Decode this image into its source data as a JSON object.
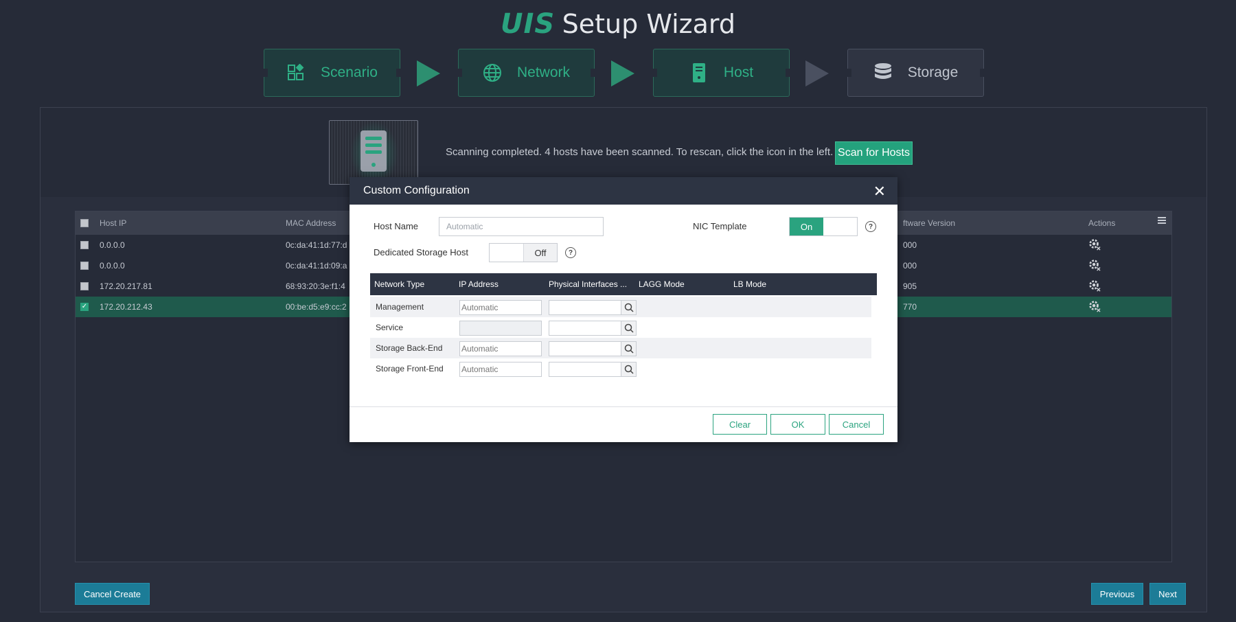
{
  "header": {
    "logo": "UIS",
    "title": "Setup Wizard"
  },
  "steps": [
    {
      "label": "Scenario",
      "icon": "scenario-icon",
      "state": "done"
    },
    {
      "label": "Network",
      "icon": "globe-icon",
      "state": "done"
    },
    {
      "label": "Host",
      "icon": "server-icon",
      "state": "current"
    },
    {
      "label": "Storage",
      "icon": "database-icon",
      "state": "pending"
    }
  ],
  "scan": {
    "message": "Scanning completed. 4 hosts have been scanned. To rescan, click the icon in the left.",
    "button": "Scan for Hosts"
  },
  "table": {
    "columns": {
      "ip": "Host IP",
      "mac": "MAC Address",
      "sw": "ftware Version",
      "actions": "Actions"
    },
    "rows": [
      {
        "ip": "0.0.0.0",
        "mac": "0c:da:41:1d:77:d",
        "sw": "000",
        "checked": false
      },
      {
        "ip": "0.0.0.0",
        "mac": "0c:da:41:1d:09:a",
        "sw": "000",
        "checked": false
      },
      {
        "ip": "172.20.217.81",
        "mac": "68:93:20:3e:f1:4",
        "sw": "905",
        "checked": false
      },
      {
        "ip": "172.20.212.43",
        "mac": "00:be:d5:e9:cc:2",
        "sw": "770",
        "checked": true
      }
    ]
  },
  "footer": {
    "cancel_create": "Cancel Create",
    "previous": "Previous",
    "next": "Next"
  },
  "modal": {
    "title": "Custom Configuration",
    "close": "✕",
    "host_name_label": "Host Name",
    "host_name_placeholder": "Automatic",
    "nic_template_label": "NIC Template",
    "nic_template_value": "On",
    "dedicated_label": "Dedicated Storage Host",
    "dedicated_value": "Off",
    "help": "?",
    "net_columns": {
      "type": "Network Type",
      "ip": "IP Address",
      "phys": "Physical Interfaces ...",
      "lagg": "LAGG Mode",
      "lb": "LB Mode"
    },
    "net_rows": [
      {
        "type": "Management",
        "ip": "Automatic",
        "disabled": false
      },
      {
        "type": "Service",
        "ip": "",
        "disabled": true
      },
      {
        "type": "Storage Back-End",
        "ip": "Automatic",
        "disabled": false
      },
      {
        "type": "Storage Front-End",
        "ip": "Automatic",
        "disabled": false
      }
    ],
    "buttons": {
      "clear": "Clear",
      "ok": "OK",
      "cancel": "Cancel"
    }
  },
  "colors": {
    "accent": "#2aa37f",
    "nav_button": "#1c7c97",
    "background": "#262b38"
  }
}
